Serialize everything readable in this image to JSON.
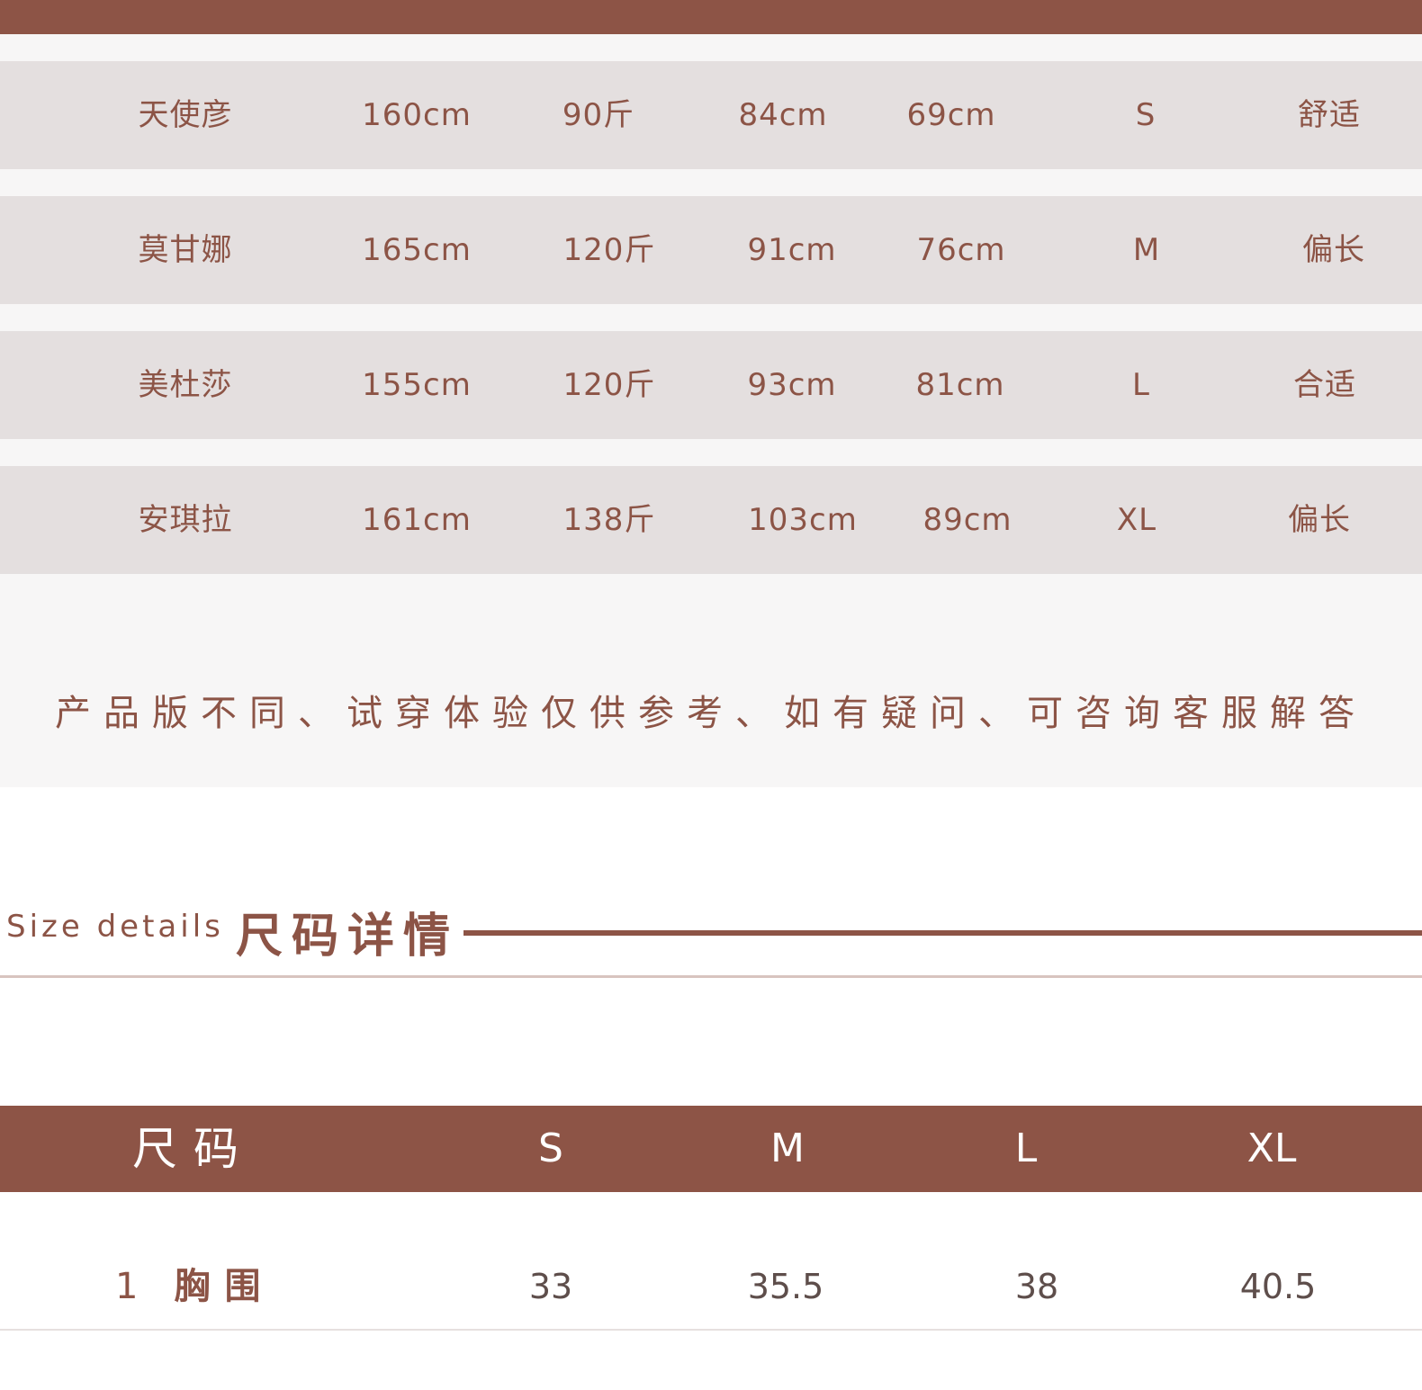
{
  "fit_table": {
    "rows": [
      {
        "name": "天使彦",
        "height": "160cm",
        "weight": "90斤",
        "bust": "84cm",
        "waist": "69cm",
        "size": "S",
        "fit": "舒适"
      },
      {
        "name": "莫甘娜",
        "height": "165cm",
        "weight": "120斤",
        "bust": "91cm",
        "waist": "76cm",
        "size": "M",
        "fit": "偏长"
      },
      {
        "name": "美杜莎",
        "height": "155cm",
        "weight": "120斤",
        "bust": "93cm",
        "waist": "81cm",
        "size": "L",
        "fit": "合适"
      },
      {
        "name": "安琪拉",
        "height": "161cm",
        "weight": "138斤",
        "bust": "103cm",
        "waist": "89cm",
        "size": "XL",
        "fit": "偏长"
      }
    ],
    "note": "产品版不同、试穿体验仅供参考、如有疑问、可咨询客服解答"
  },
  "size_details": {
    "title_en": "Size details",
    "title_cn": "尺码详情",
    "header": [
      "尺码",
      "S",
      "M",
      "L",
      "XL"
    ],
    "rows": [
      {
        "index": "1",
        "label": "胸围",
        "values": [
          "33",
          "35.5",
          "38",
          "40.5"
        ]
      }
    ]
  },
  "colors": {
    "accent": "#8d5446",
    "row_bg": "#e4dfdf",
    "panel_bg": "#f7f6f6"
  }
}
